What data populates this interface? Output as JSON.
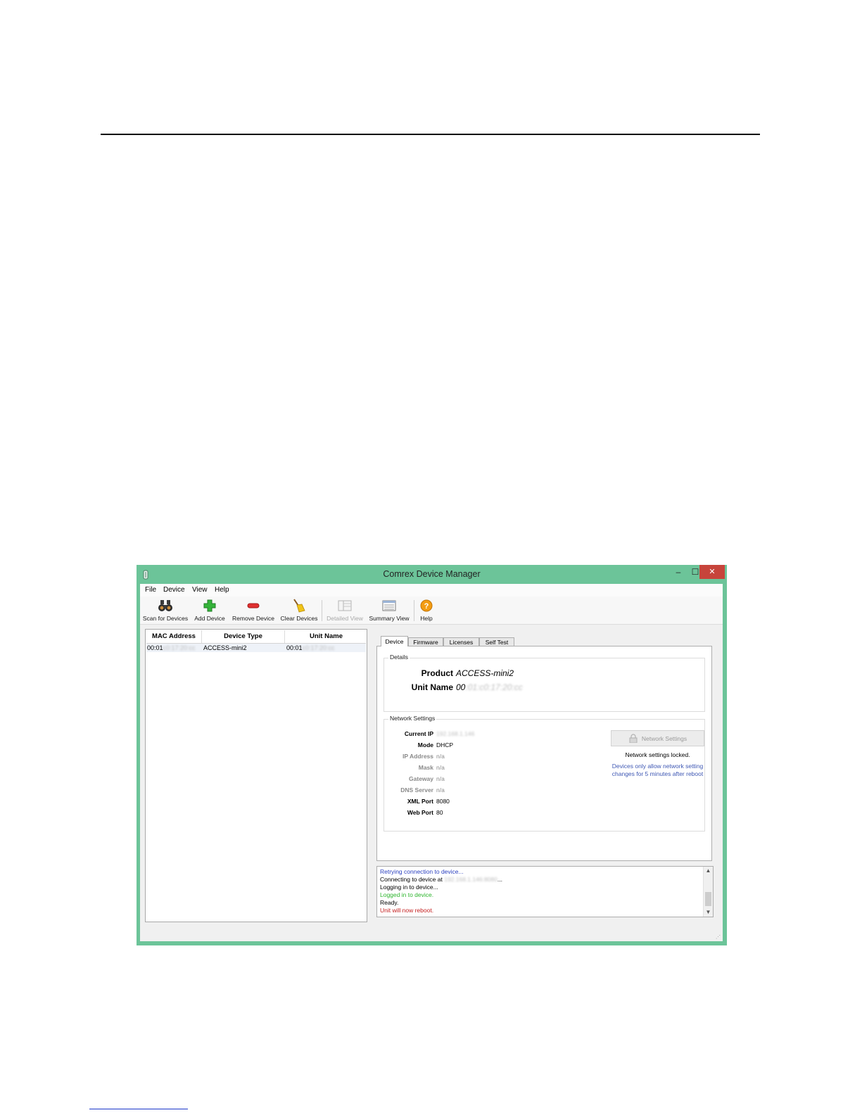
{
  "window": {
    "title": "Comrex Device Manager",
    "close_glyph": "✕",
    "min_glyph": "–",
    "max_glyph": "☐"
  },
  "menu": [
    "File",
    "Device",
    "View",
    "Help"
  ],
  "toolbar": {
    "scan": "Scan for Devices",
    "add": "Add Device",
    "remove": "Remove Device",
    "clear": "Clear Devices",
    "detailed": "Detailed View",
    "summary": "Summary View",
    "help": "Help"
  },
  "device_list": {
    "columns": [
      "MAC Address",
      "Device Type",
      "Unit Name"
    ],
    "rows": [
      {
        "mac_prefix": "00:01",
        "mac_rest": "c0:17:20:cc",
        "type": "ACCESS-mini2",
        "name_prefix": "00:01",
        "name_rest": "c0:17:20:cc"
      }
    ]
  },
  "tabs": [
    "Device",
    "Firmware",
    "Licenses",
    "Self Test"
  ],
  "details": {
    "title": "Details",
    "product_label": "Product",
    "product_value": "ACCESS-mini2",
    "unit_label": "Unit Name",
    "unit_prefix": "00",
    "unit_rest": ":01:c0:17:20:cc"
  },
  "network": {
    "title": "Network Settings",
    "rows": [
      {
        "label": "Current IP",
        "value": "192.168.1.146"
      },
      {
        "label": "Mode",
        "value": "DHCP"
      },
      {
        "label": "IP Address",
        "value": "n/a"
      },
      {
        "label": "Mask",
        "value": "n/a"
      },
      {
        "label": "Gateway",
        "value": "n/a"
      },
      {
        "label": "DNS Server",
        "value": "n/a"
      },
      {
        "label": "XML Port",
        "value": "8080"
      },
      {
        "label": "Web Port",
        "value": "80"
      }
    ],
    "button": "Network Settings",
    "locked": "Network settings locked.",
    "note_1": "Devices only allow network setting",
    "note_2": "changes for 5 minutes after reboot"
  },
  "log": {
    "lines": [
      {
        "text": "Retrying connection to device...",
        "color": "#2a3fbf"
      },
      {
        "text": "Connecting to device at",
        "blur": "192.168.1.146:8080",
        "tail": "...",
        "color": "#000000"
      },
      {
        "text": "Logging in to device...",
        "color": "#000000"
      },
      {
        "text": "Logged in to device.",
        "color": "#2db52d"
      },
      {
        "text": "Ready.",
        "color": "#000000"
      },
      {
        "text": "Unit will now reboot.",
        "color": "#c42020"
      }
    ]
  },
  "colors": {
    "titlebar": "#6cc499",
    "close": "#c7443b",
    "link_blue": "#3f58b4"
  }
}
